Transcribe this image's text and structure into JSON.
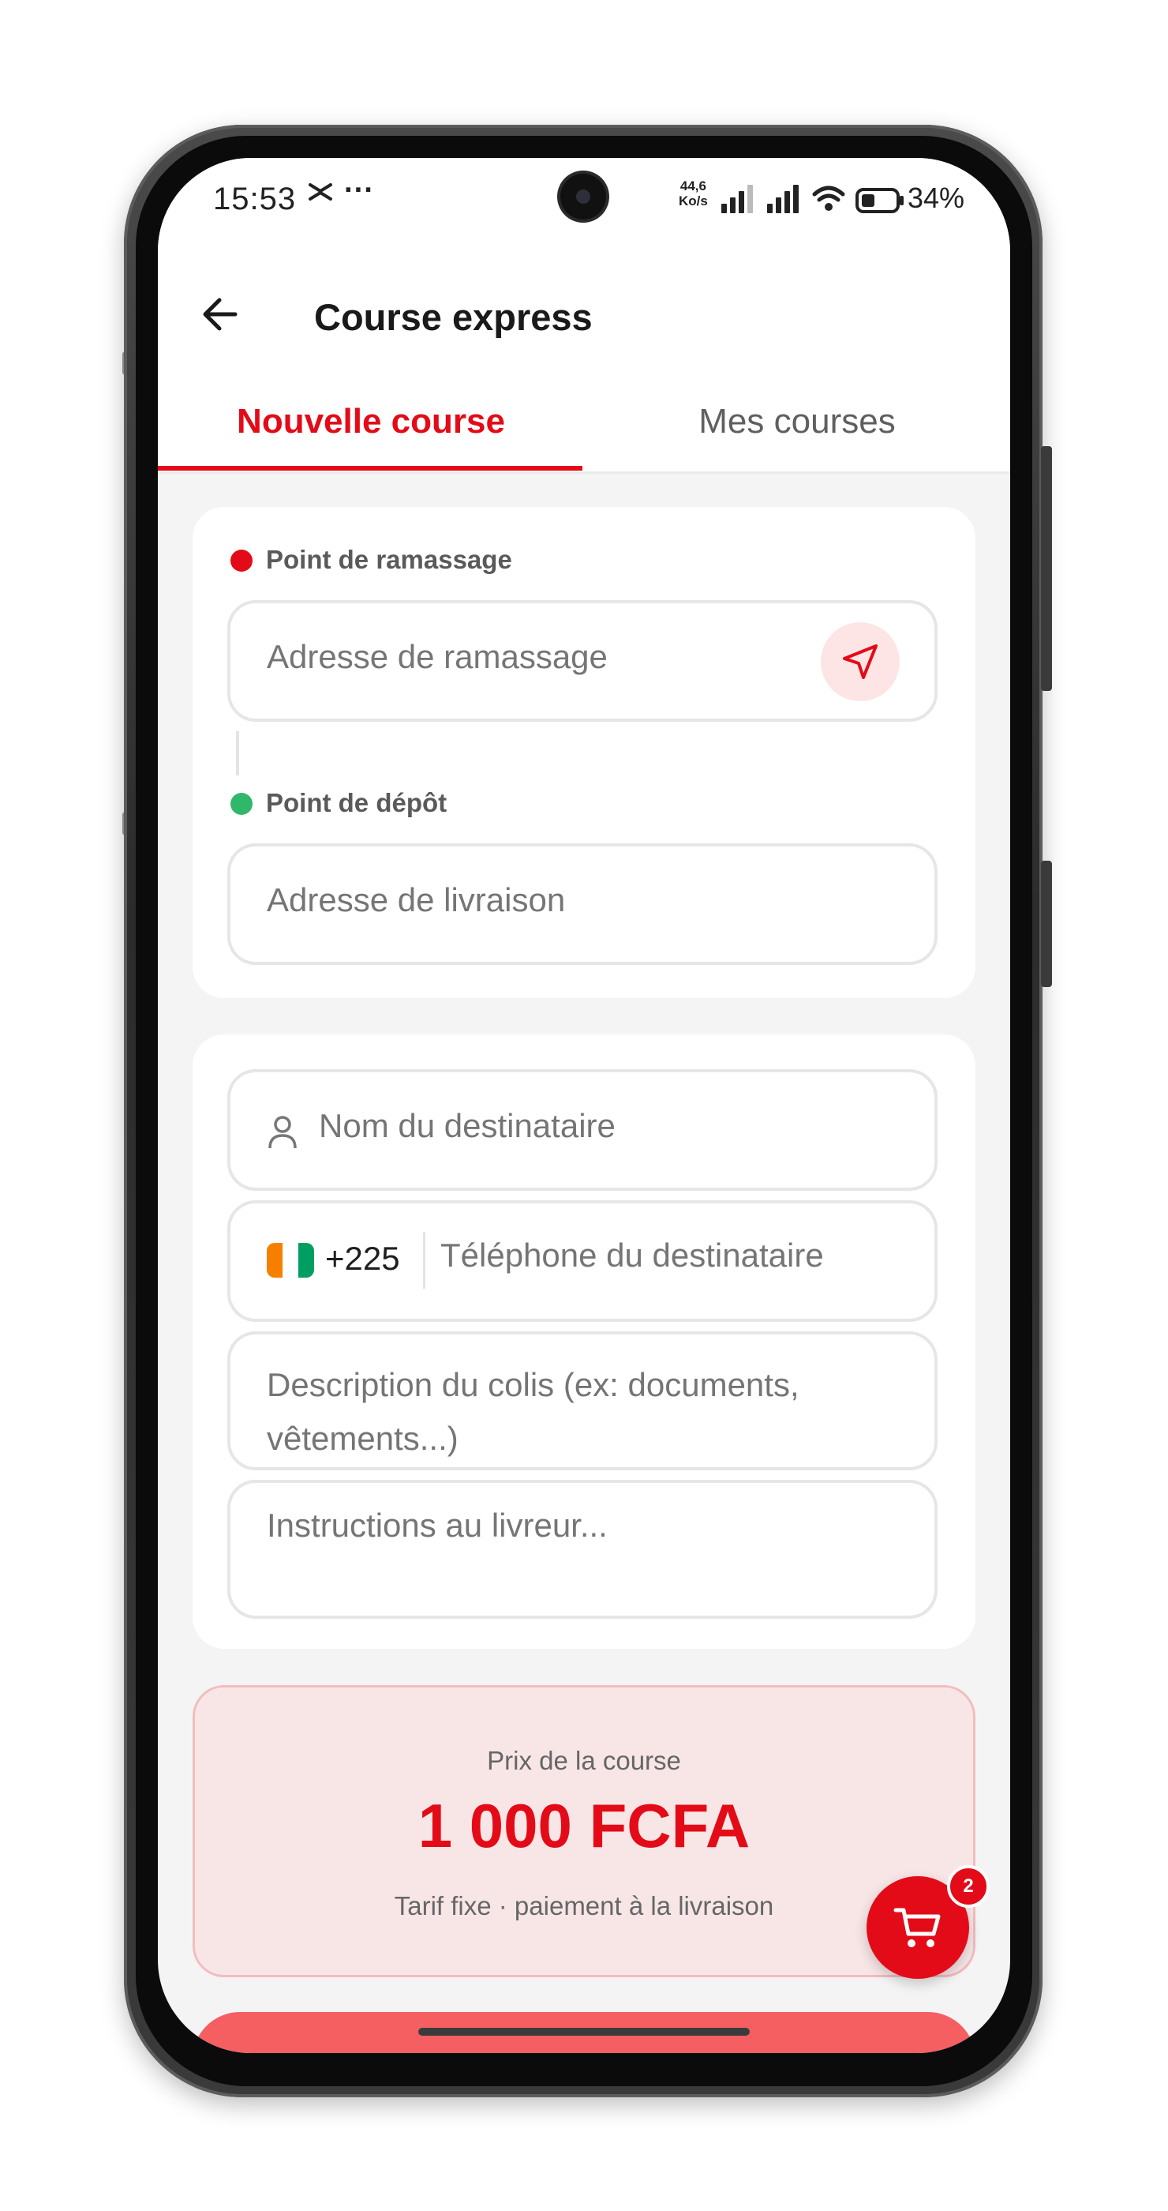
{
  "status_bar": {
    "time": "15:53",
    "extra_icon": "capcut-icon",
    "more": "···",
    "net_speed_value": "44,6",
    "net_speed_unit": "Ko/s",
    "battery": "34%"
  },
  "header": {
    "title": "Course express",
    "back_icon": "arrow-left-icon"
  },
  "tabs": [
    {
      "label": "Nouvelle course",
      "active": true
    },
    {
      "label": "Mes courses",
      "active": false
    }
  ],
  "addresses": {
    "pickup_label": "Point de ramassage",
    "pickup_placeholder": "Adresse de ramassage",
    "dropoff_label": "Point de dépôt",
    "dropoff_placeholder": "Adresse de livraison"
  },
  "recipient": {
    "name_placeholder": "Nom du destinataire",
    "dial_code": "+225",
    "phone_placeholder": "Téléphone du destinataire",
    "description_placeholder": "Description du colis (ex: documents, vêtements...)",
    "instructions_placeholder": "Instructions au livreur..."
  },
  "price": {
    "label": "Prix de la course",
    "value": "1 000 FCFA",
    "note": "Tarif fixe · paiement à la livraison"
  },
  "cart": {
    "badge_count": "2"
  },
  "colors": {
    "accent": "#e30b17",
    "pickup_dot": "#e30b17",
    "dropoff_dot": "#2fb86a",
    "price_bg": "#f8e6e7",
    "submit_bg": "#f55f62"
  }
}
